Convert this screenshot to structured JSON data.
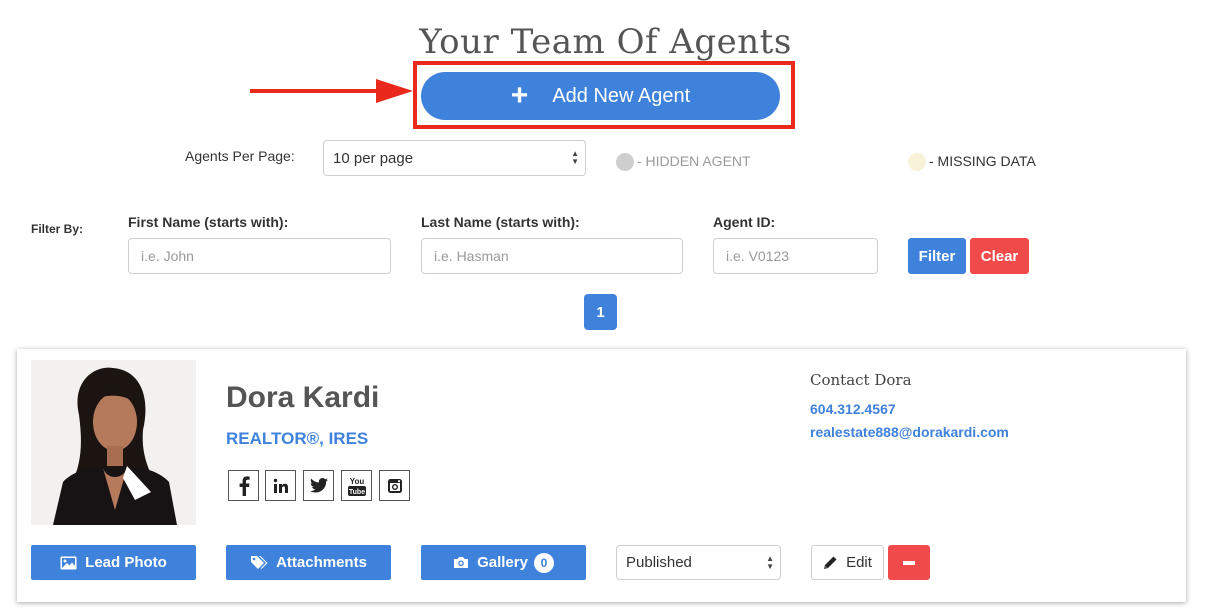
{
  "page": {
    "title": "Your Team Of Agents",
    "add_agent_label": "Add New Agent"
  },
  "pagination_controls": {
    "per_page_label": "Agents Per Page:",
    "per_page_value": "10 per page",
    "legend": {
      "hidden_label": "- HIDDEN AGENT",
      "missing_label": "- MISSING DATA",
      "hidden_color": "#cfcfcf",
      "missing_color": "#f7f2d8"
    }
  },
  "filter": {
    "label": "Filter By:",
    "first_name": {
      "label": "First Name (starts with):",
      "placeholder": "i.e. John",
      "value": ""
    },
    "last_name": {
      "label": "Last Name (starts with):",
      "placeholder": "i.e. Hasman",
      "value": ""
    },
    "agent_id": {
      "label": "Agent ID:",
      "placeholder": "i.e. V0123",
      "value": ""
    },
    "filter_button": "Filter",
    "clear_button": "Clear"
  },
  "pages": [
    "1"
  ],
  "agent": {
    "name": "Dora Kardi",
    "title": "REALTOR®, IRES",
    "social_icons": [
      "facebook-icon",
      "linkedin-icon",
      "twitter-icon",
      "youtube-icon",
      "instagram-icon"
    ],
    "contact_heading": "Contact Dora",
    "phone": "604.312.4567",
    "email": "realestate888@dorakardi.com",
    "lead_photo_label": "Lead Photo",
    "attachments_label": "Attachments",
    "gallery_label": "Gallery",
    "gallery_count": "0",
    "status": "Published",
    "edit_label": "Edit"
  },
  "colors": {
    "primary": "#3f82dc",
    "danger": "#f04a4a",
    "highlight": "#e8291c"
  }
}
